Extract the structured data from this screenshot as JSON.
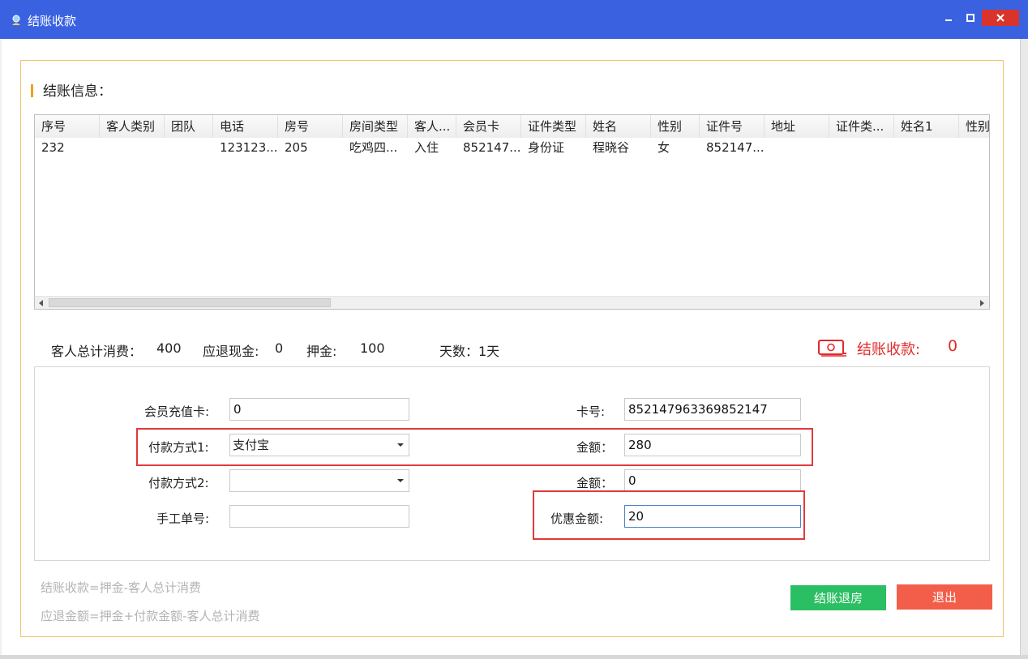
{
  "window": {
    "title": "结账收款",
    "colors": {
      "titlebar": "#3a62e0",
      "accent": "#f0a020",
      "danger": "#e02a2a"
    }
  },
  "section": {
    "title": "结账信息："
  },
  "table": {
    "columns": [
      "序号",
      "客人类别",
      "团队",
      "电话",
      "房号",
      "房间类型",
      "客人...",
      "会员卡",
      "证件类型",
      "姓名",
      "性别",
      "证件号",
      "地址",
      "证件类...",
      "姓名1",
      "性别"
    ],
    "rows": [
      [
        "232",
        "",
        "",
        "123123...",
        "205",
        "吃鸡四...",
        "入住",
        "852147...",
        "身份证",
        "程晓谷",
        "女",
        "852147...",
        "",
        "",
        "",
        ""
      ]
    ]
  },
  "summary": {
    "total_label": "客人总计消费：",
    "total_value": "400",
    "refund_label": "应退现金:",
    "refund_value": "0",
    "deposit_label": "押金:",
    "deposit_value": "100",
    "days_label": "天数：1天",
    "checkout_label": "结账收款:",
    "checkout_value": "0"
  },
  "form": {
    "member_card_label": "会员充值卡:",
    "member_card_value": "0",
    "card_no_label": "卡号:",
    "card_no_value": "852147963369852147",
    "pay1_label": "付款方式1:",
    "pay1_value": "支付宝",
    "amount1_label": "金额：",
    "amount1_value": "280",
    "pay2_label": "付款方式2:",
    "pay2_value": "",
    "amount2_label": "金额：",
    "amount2_value": "0",
    "manual_no_label": "手工单号:",
    "manual_no_value": "",
    "discount_label": "优惠金额:",
    "discount_value": "20"
  },
  "formulas": {
    "line1": "结账收款=押金-客人总计消费",
    "line2": "应退金额=押金+付款金额-客人总计消费"
  },
  "buttons": {
    "checkout": "结账退房",
    "exit": "退出"
  }
}
